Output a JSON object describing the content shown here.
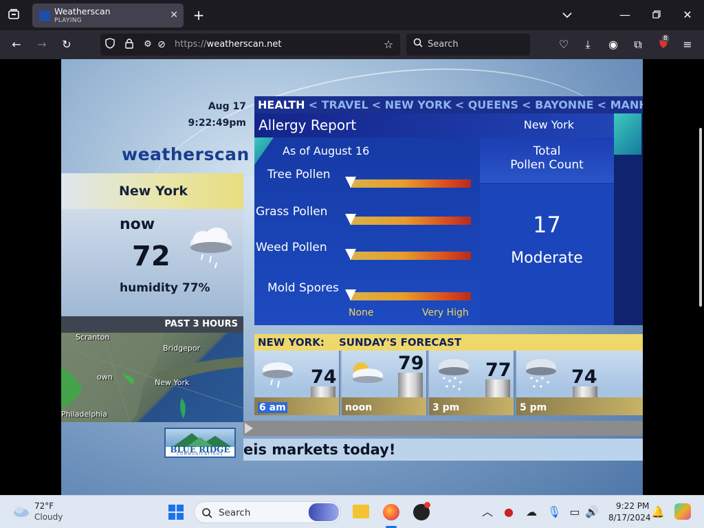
{
  "browser": {
    "tab": {
      "title": "Weatherscan",
      "status": "PLAYING"
    },
    "url_scheme": "https://",
    "url_host": "weatherscan.net",
    "search_placeholder": "Search",
    "extension_badge": "8"
  },
  "weatherscan": {
    "date": "Aug 17",
    "time": "9:22:49pm",
    "logo": "weatherscan",
    "city": "New York",
    "now_label": "now",
    "current_temp": "72",
    "humidity": "humidity 77%",
    "past_label": "PAST 3 HOURS",
    "map_labels": [
      "Scranton",
      "Bridgepor",
      "New York",
      "Philadelphia",
      "own"
    ],
    "nav": {
      "active": "HEALTH",
      "items": [
        "< TRAVEL",
        "< NEW YORK",
        "< QUEENS",
        "< BAYONNE",
        "< MANHA"
      ]
    },
    "report": {
      "title": "Allergy Report",
      "city": "New York",
      "as_of": "As of August 16",
      "pollen": [
        {
          "label": "Tree Pollen",
          "level": 0
        },
        {
          "label": "Grass Pollen",
          "level": 0
        },
        {
          "label": "Weed Pollen",
          "level": 0
        },
        {
          "label": "Mold Spores",
          "level": 0
        }
      ],
      "scale_low": "None",
      "scale_high": "Very High",
      "total_title_1": "Total",
      "total_title_2": "Pollen Count",
      "total_count": "17",
      "total_level": "Moderate"
    },
    "forecast": {
      "location": "NEW YORK:",
      "title": "SUNDAY'S FORECAST",
      "periods": [
        {
          "time": "6 am",
          "temp": "74",
          "icon": "cloud-rain-icon",
          "temp_value": 74
        },
        {
          "time": "noon",
          "temp": "79",
          "icon": "partly-cloudy-icon",
          "temp_value": 79
        },
        {
          "time": "3 pm",
          "temp": "77",
          "icon": "rain-shower-icon",
          "temp_value": 77
        },
        {
          "time": "5 pm",
          "temp": "74",
          "icon": "rain-shower-icon",
          "temp_value": 74
        }
      ]
    },
    "ad": {
      "name": "BLUE RIDGE",
      "sub": "COMMUNICATIONS"
    },
    "crawl": "eis markets today!"
  },
  "taskbar": {
    "weather_temp": "72°F",
    "weather_desc": "Cloudy",
    "search": "Search",
    "time": "9:22 PM",
    "date": "8/17/2024"
  },
  "colors": {
    "nav_bar": "#1a2f8e",
    "nav_inactive": "#8fb3ec",
    "forecast_header": "#efd86a",
    "scale_text": "#f1d45f"
  }
}
